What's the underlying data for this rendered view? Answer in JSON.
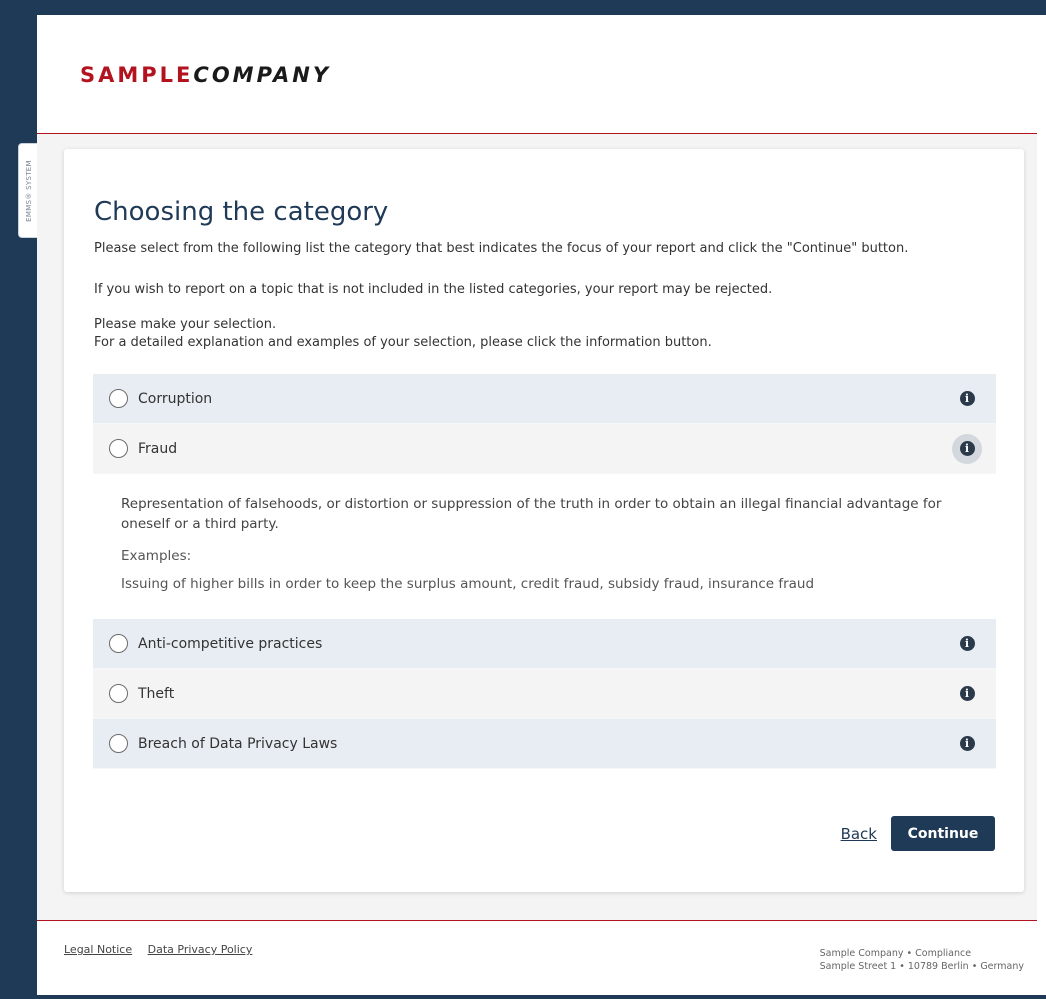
{
  "app": {
    "side_tab": "EMMS® SYSTEM",
    "logo_part1": "SAMPLE",
    "logo_part2": "COMPANY"
  },
  "page": {
    "title": "Choosing the category",
    "intro_1": "Please select from the following list the category that best indicates the focus of your report and click the \"Continue\" button.",
    "intro_2": "If you wish to report on a topic that is not included in the listed categories, your report may be rejected.",
    "intro_3": "Please make your selection.",
    "intro_4": "For a detailed explanation and examples of your selection, please click the information button."
  },
  "categories": [
    {
      "label": "Corruption"
    },
    {
      "label": "Fraud"
    },
    {
      "label": "Anti-competitive practices"
    },
    {
      "label": "Theft"
    },
    {
      "label": "Breach of Data Privacy Laws"
    }
  ],
  "expanded": {
    "description": "Representation of falsehoods, or distortion or suppression of the truth in order to obtain an illegal financial advantage for oneself or a third party.",
    "examples_label": "Examples:",
    "examples_text": "Issuing of higher bills in order to keep the surplus amount, credit fraud, subsidy fraud, insurance fraud"
  },
  "actions": {
    "back_label": "Back",
    "continue_label": "Continue"
  },
  "footer": {
    "legal_notice": "Legal Notice",
    "privacy_policy": "Data Privacy Policy",
    "address_line1": "Sample Company  • Compliance",
    "address_line2": "Sample Street 1  • 10789 Berlin  • Germany"
  },
  "icons": {
    "info": "info-circle-icon",
    "radio": "radio-unchecked"
  },
  "colors": {
    "navy": "#1f3a57",
    "brand_red": "#b3121f"
  }
}
